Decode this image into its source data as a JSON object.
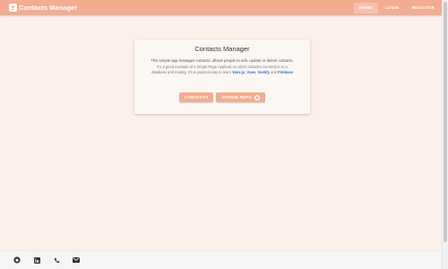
{
  "header": {
    "title": "Contacts Manager",
    "nav": [
      {
        "label": "Home",
        "active": true
      },
      {
        "label": "Login",
        "active": false
      },
      {
        "label": "Register",
        "active": false
      }
    ]
  },
  "card": {
    "title": "Contacts Manager",
    "line1": "This simple app manages contacts, allows people to edit, update or delete contacts.",
    "line2": "It's a good example of a Single-Page Applicati on which includes connection to a",
    "line3_prefix": "database and routing. It's a practical way to learn",
    "tech": [
      "Vuex.js",
      "Vuex",
      "Vuetify",
      "Firebase"
    ],
    "sep_comma": ",",
    "sep_and": "and",
    "buttons": {
      "contacts": "Contacts",
      "github": "Github Repo"
    }
  },
  "footer": {
    "icons": [
      "github-icon",
      "linkedin-icon",
      "phone-icon",
      "email-icon"
    ]
  },
  "colors": {
    "accent": "#f2ad91",
    "background": "#fdefe9",
    "link": "#1976d2"
  }
}
